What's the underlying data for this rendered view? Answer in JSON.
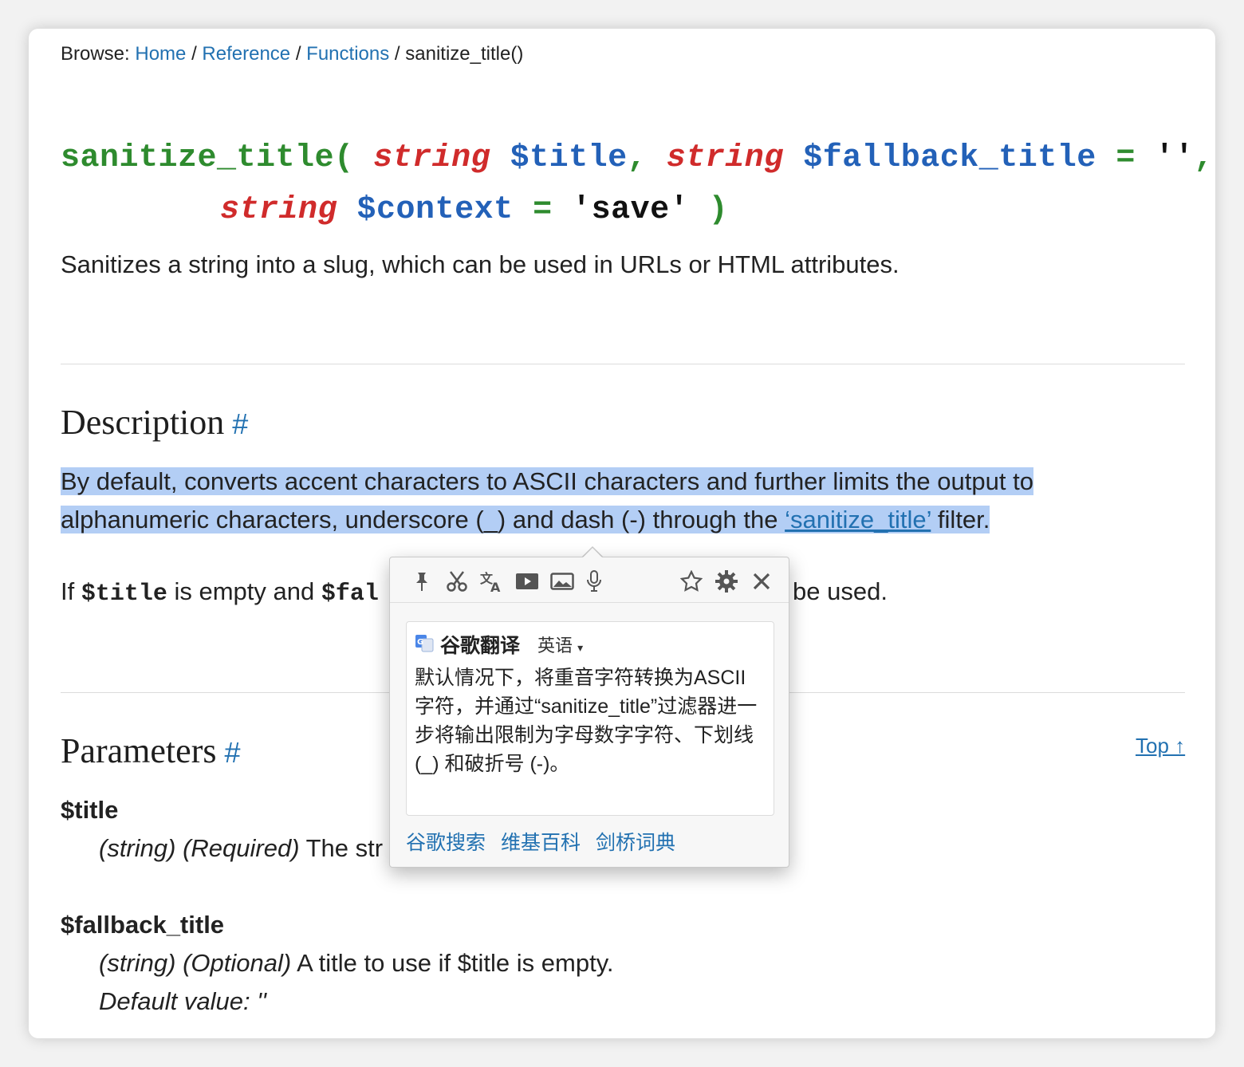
{
  "breadcrumb": {
    "prefix": "Browse:",
    "home": "Home",
    "reference": "Reference",
    "functions": "Functions",
    "current": "sanitize_title()"
  },
  "signature": {
    "fn_name": "sanitize_title(",
    "type1": "string",
    "var1": "$title",
    "type2": "string",
    "var2": "$fallback_title",
    "eq": "=",
    "default2": "''",
    "type3": "string",
    "var3": "$context",
    "default3": "'save'",
    "close": ")"
  },
  "summary": "Sanitizes a string into a slug, which can be used in URLs or HTML attributes.",
  "description": {
    "heading": "Description",
    "hash": "#",
    "line1": "By default, converts accent characters to ASCII characters and further limits the output to",
    "line2_pre": "alphanumeric characters, underscore (_) and dash (-) through the ",
    "line2_link": "‘sanitize_title’",
    "line2_post": " filter.",
    "para2_if": "If ",
    "para2_code1": "$title",
    "para2_mid": " is empty and ",
    "para2_code2": "$fal",
    "para2_tail": "be used."
  },
  "parameters": {
    "heading": "Parameters",
    "hash": "#",
    "top_link": "Top ↑",
    "title_name": "$title",
    "title_desc_italic": "(string) (Required)",
    "title_desc_text": " The str",
    "fallback_name": "$fallback_title",
    "fallback_desc_italic": "(string) (Optional)",
    "fallback_desc_text": " A title to use if $title is empty.",
    "fallback_default": "Default value: ''"
  },
  "popup": {
    "toolbar_icons": [
      "pin-icon",
      "scissors-icon",
      "translate-icon",
      "video-icon",
      "image-icon",
      "microphone-icon",
      "star-icon",
      "gear-icon",
      "close-icon"
    ],
    "translator_name": "谷歌翻译",
    "language": "英语",
    "translation": "默认情况下，将重音字符转换为ASCII 字符，并通过“sanitize_title”过滤器进一步将输出限制为字母数字字符、下划线 (_) 和破折号 (-)。",
    "links": [
      "谷歌搜索",
      "维基百科",
      "剑桥词典"
    ]
  },
  "colors": {
    "link": "#2271b1",
    "highlight": "#b3cef5",
    "fn_green": "#2e8b2e",
    "type_red": "#d02b2b",
    "var_blue": "#2361b8"
  }
}
